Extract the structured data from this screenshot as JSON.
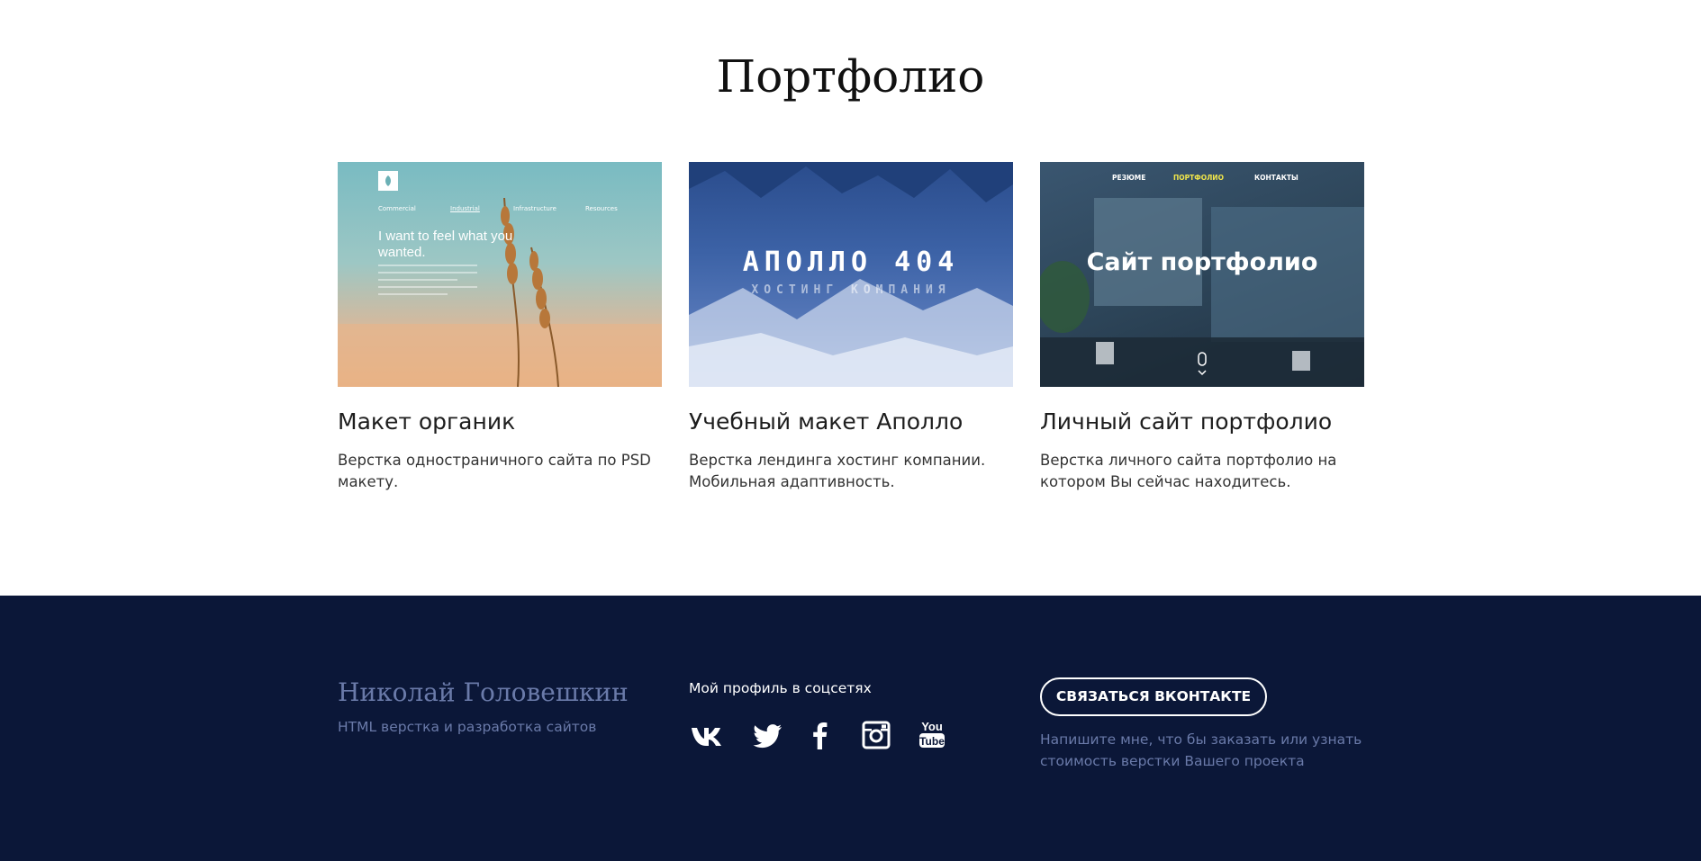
{
  "portfolio": {
    "title": "Портфолио",
    "items": [
      {
        "title": "Макет органик",
        "description": "Верстка одностраничного сайта по PSD макету.",
        "preview": {
          "nav": [
            "Commercial",
            "Industrial",
            "Infrastructure",
            "Resources"
          ],
          "headline": "I want to feel what you wanted."
        }
      },
      {
        "title": "Учебный макет Аполло",
        "description": "Верстка лендинга хостинг компании. Мобильная адаптивность.",
        "preview": {
          "headline": "АПОЛЛО 404",
          "subheadline": "ХОСТИНГ КОМПАНИЯ"
        }
      },
      {
        "title": "Личный сайт портфолио",
        "description": "Верстка личного сайта портфолио на котором Вы сейчас находитесь.",
        "preview": {
          "nav": [
            "РЕЗЮМЕ",
            "ПОРТФОЛИО",
            "КОНТАКТЫ"
          ],
          "headline": "Сайт портфолио"
        }
      }
    ]
  },
  "footer": {
    "name": "Николай Головешкин",
    "role": "HTML верстка и разработка сайтов",
    "social_label": "Мой профиль в соцсетях",
    "social_icons": [
      "vk-icon",
      "twitter-icon",
      "facebook-icon",
      "instagram-icon",
      "youtube-icon"
    ],
    "youtube_logo": [
      "You",
      "Tube"
    ],
    "contact_button": "СВЯЗАТЬСЯ ВКОНТАКТЕ",
    "contact_note": "Напишите мне, что бы заказать или узнать стоимость верстки Вашего проекта"
  },
  "colors": {
    "footer_bg": "#0b1738",
    "footer_muted": "#6a7aa9",
    "active_nav": "#f1e64a"
  }
}
